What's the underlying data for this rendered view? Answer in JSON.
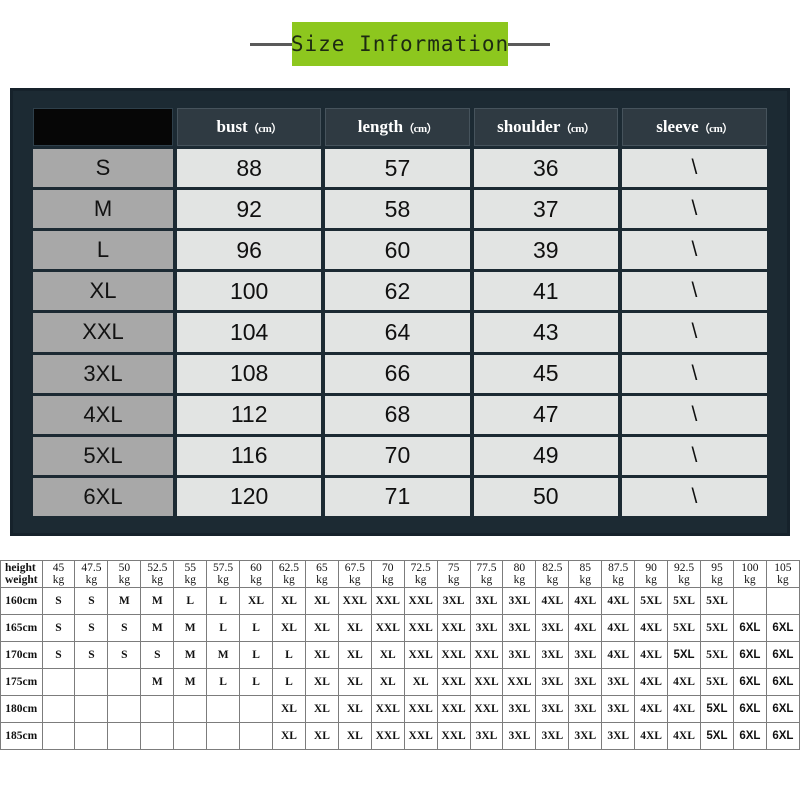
{
  "banner": {
    "title": "Size Information"
  },
  "size_table": {
    "headers": [
      "",
      "bust（cm）",
      "length（cm）",
      "shoulder（cm）",
      "sleeve（cm）"
    ],
    "header_labels": [
      "",
      "bust",
      "length",
      "shoulder",
      "sleeve"
    ],
    "header_unit": "（cm）",
    "rows": [
      {
        "size": "S",
        "bust": "88",
        "length": "57",
        "shoulder": "36",
        "sleeve": "\\"
      },
      {
        "size": "M",
        "bust": "92",
        "length": "58",
        "shoulder": "37",
        "sleeve": "\\"
      },
      {
        "size": "L",
        "bust": "96",
        "length": "60",
        "shoulder": "39",
        "sleeve": "\\"
      },
      {
        "size": "XL",
        "bust": "100",
        "length": "62",
        "shoulder": "41",
        "sleeve": "\\"
      },
      {
        "size": "XXL",
        "bust": "104",
        "length": "64",
        "shoulder": "43",
        "sleeve": "\\"
      },
      {
        "size": "3XL",
        "bust": "108",
        "length": "66",
        "shoulder": "45",
        "sleeve": "\\"
      },
      {
        "size": "4XL",
        "bust": "112",
        "length": "68",
        "shoulder": "47",
        "sleeve": "\\"
      },
      {
        "size": "5XL",
        "bust": "116",
        "length": "70",
        "shoulder": "49",
        "sleeve": "\\"
      },
      {
        "size": "6XL",
        "bust": "120",
        "length": "71",
        "shoulder": "50",
        "sleeve": "\\"
      }
    ]
  },
  "fit_grid": {
    "corner_top": "height",
    "corner_bottom": "weight",
    "weight_unit": "kg",
    "weights": [
      "45",
      "47.5",
      "50",
      "52.5",
      "55",
      "57.5",
      "60",
      "62.5",
      "65",
      "67.5",
      "70",
      "72.5",
      "75",
      "77.5",
      "80",
      "82.5",
      "85",
      "87.5",
      "90",
      "92.5",
      "95",
      "100",
      "105"
    ],
    "rows": [
      {
        "height": "160cm",
        "cells": [
          "S",
          "S",
          "M",
          "M",
          "L",
          "L",
          "XL",
          "XL",
          "XL",
          "XXL",
          "XXL",
          "XXL",
          "3XL",
          "3XL",
          "3XL",
          "4XL",
          "4XL",
          "4XL",
          "5XL",
          "5XL",
          "5XL",
          "",
          ""
        ],
        "faint": [
          false,
          false,
          false,
          false,
          false,
          false,
          false,
          false,
          false,
          false,
          false,
          false,
          false,
          false,
          false,
          false,
          false,
          false,
          false,
          false,
          false,
          false,
          false
        ]
      },
      {
        "height": "165cm",
        "cells": [
          "S",
          "S",
          "S",
          "M",
          "M",
          "L",
          "L",
          "XL",
          "XL",
          "XL",
          "XXL",
          "XXL",
          "XXL",
          "3XL",
          "3XL",
          "3XL",
          "4XL",
          "4XL",
          "4XL",
          "5XL",
          "5XL",
          "6XL",
          "6XL"
        ],
        "faint": [
          false,
          false,
          false,
          false,
          false,
          false,
          false,
          false,
          false,
          false,
          false,
          false,
          false,
          false,
          false,
          false,
          false,
          false,
          false,
          false,
          false,
          true,
          true
        ]
      },
      {
        "height": "170cm",
        "cells": [
          "S",
          "S",
          "S",
          "S",
          "M",
          "M",
          "L",
          "L",
          "XL",
          "XL",
          "XL",
          "XXL",
          "XXL",
          "XXL",
          "3XL",
          "3XL",
          "3XL",
          "4XL",
          "4XL",
          "5XL",
          "5XL",
          "6XL",
          "6XL"
        ],
        "faint": [
          false,
          false,
          false,
          false,
          false,
          false,
          false,
          false,
          false,
          false,
          false,
          false,
          false,
          false,
          false,
          false,
          false,
          false,
          false,
          true,
          false,
          true,
          true
        ]
      },
      {
        "height": "175cm",
        "cells": [
          "",
          "",
          "",
          "M",
          "M",
          "L",
          "L",
          "L",
          "XL",
          "XL",
          "XL",
          "XL",
          "XXL",
          "XXL",
          "XXL",
          "3XL",
          "3XL",
          "3XL",
          "4XL",
          "4XL",
          "5XL",
          "6XL",
          "6XL"
        ],
        "faint": [
          false,
          false,
          false,
          false,
          false,
          false,
          false,
          false,
          false,
          false,
          false,
          false,
          false,
          false,
          false,
          false,
          false,
          false,
          false,
          false,
          false,
          true,
          true
        ]
      },
      {
        "height": "180cm",
        "cells": [
          "",
          "",
          "",
          "",
          "",
          "",
          "",
          "XL",
          "XL",
          "XL",
          "XXL",
          "XXL",
          "XXL",
          "XXL",
          "3XL",
          "3XL",
          "3XL",
          "3XL",
          "4XL",
          "4XL",
          "5XL",
          "6XL",
          "6XL"
        ],
        "faint": [
          false,
          false,
          false,
          false,
          false,
          false,
          false,
          false,
          false,
          false,
          false,
          false,
          false,
          false,
          false,
          false,
          false,
          false,
          false,
          false,
          true,
          true,
          true
        ]
      },
      {
        "height": "185cm",
        "cells": [
          "",
          "",
          "",
          "",
          "",
          "",
          "",
          "XL",
          "XL",
          "XL",
          "XXL",
          "XXL",
          "XXL",
          "3XL",
          "3XL",
          "3XL",
          "3XL",
          "3XL",
          "4XL",
          "4XL",
          "5XL",
          "6XL",
          "6XL"
        ],
        "faint": [
          false,
          false,
          false,
          false,
          false,
          false,
          false,
          false,
          false,
          false,
          false,
          false,
          false,
          false,
          false,
          false,
          false,
          false,
          false,
          false,
          true,
          true,
          true
        ]
      }
    ]
  },
  "colors": {
    "banner_green": "#8dc71e",
    "panel_dark": "#1c2a33",
    "header_cell": "#2f3a42",
    "size_cell": "#a8a8a8",
    "value_cell": "#e2e4e3",
    "blank_cell": "#060606",
    "grid_border": "#7c7c7c",
    "faint_text": "#aaaaaa"
  }
}
